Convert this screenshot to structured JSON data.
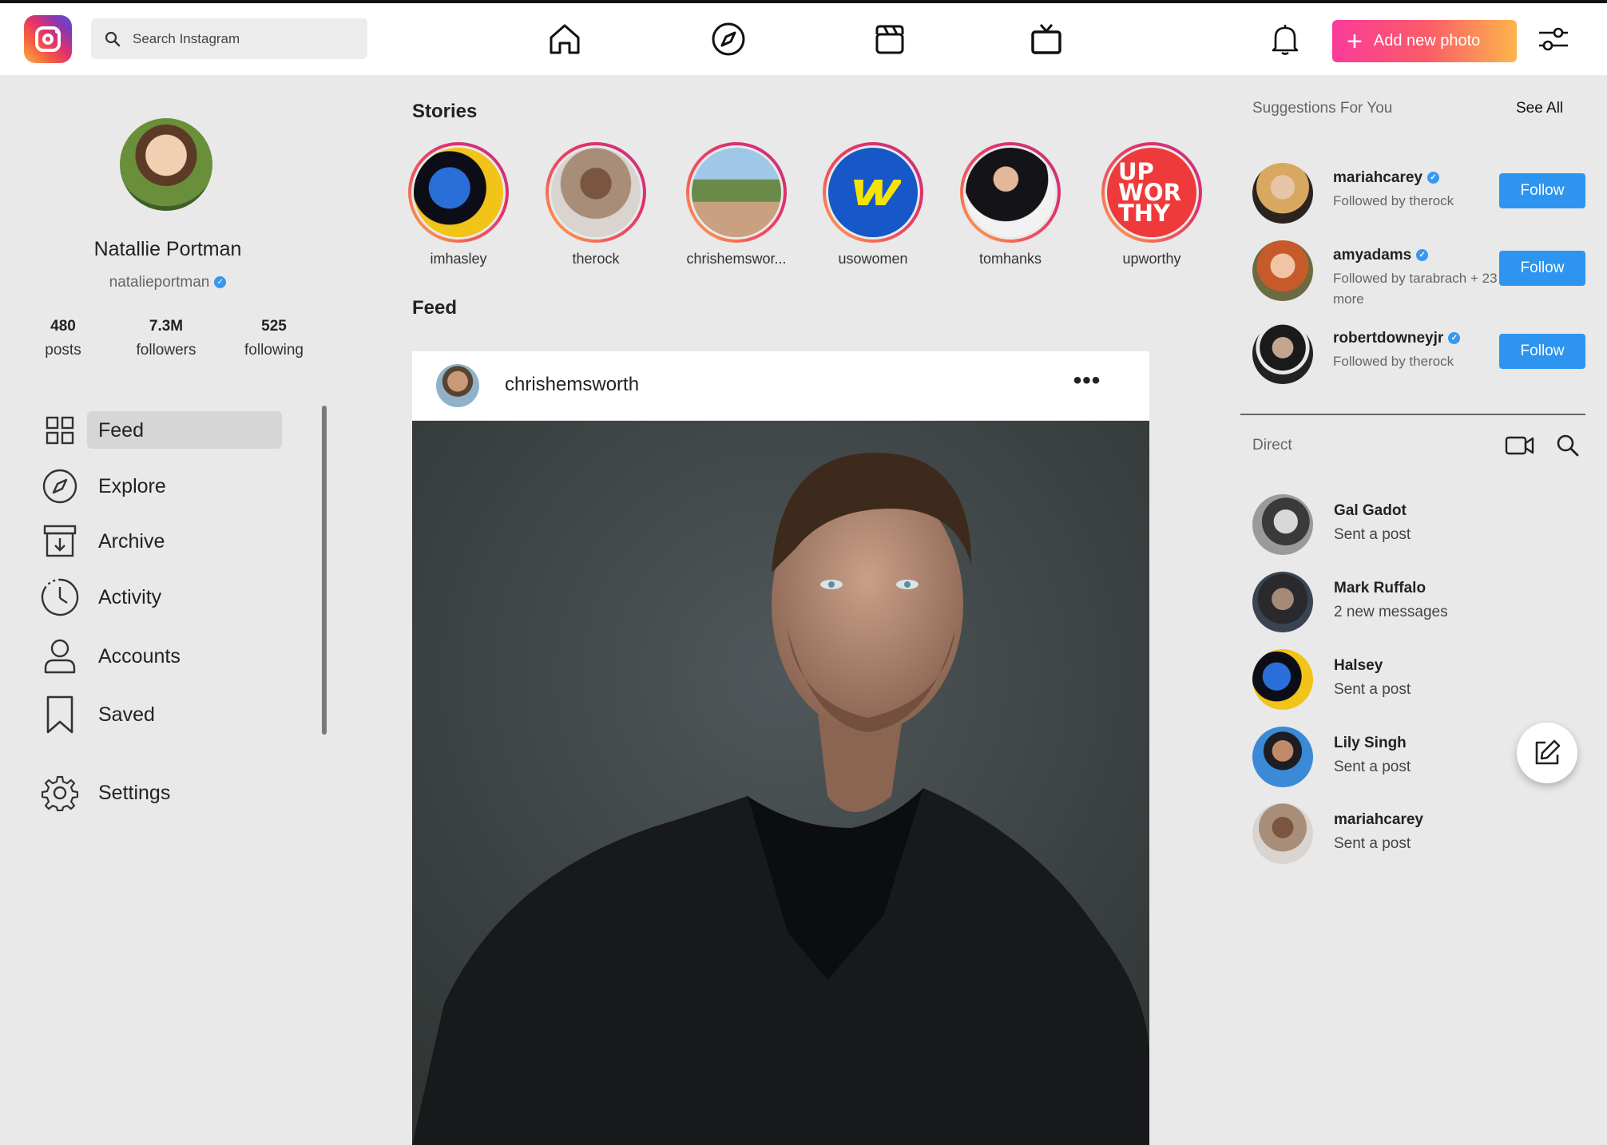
{
  "header": {
    "search_placeholder": "Search Instagram",
    "add_photo_label": "Add new photo",
    "plus_glyph": "+"
  },
  "profile": {
    "name": "Natallie Portman",
    "handle": "natalieportman",
    "stats": [
      {
        "num": "480",
        "label": "posts"
      },
      {
        "num": "7.3M",
        "label": "followers"
      },
      {
        "num": "525",
        "label": "following"
      }
    ]
  },
  "menu": {
    "feed": "Feed",
    "explore": "Explore",
    "archive": "Archive",
    "activity": "Activity",
    "accounts": "Accounts",
    "saved": "Saved",
    "settings": "Settings"
  },
  "stories": {
    "title": "Stories",
    "items": [
      "imhasley",
      "therock",
      "chrishemswor...",
      "usowomen",
      "tomhanks",
      "upworthy"
    ],
    "upworthy_logo_text": "UP WOR THY"
  },
  "feed": {
    "title": "Feed",
    "post": {
      "username": "chrishemsworth",
      "more_glyph": "•••"
    }
  },
  "suggestions": {
    "title": "Suggestions For You",
    "see_all": "See All",
    "follow_label": "Follow",
    "items": [
      {
        "username": "mariahcarey",
        "sub": "Followed by therock"
      },
      {
        "username": "amyadams",
        "sub": "Followed by tarabrach + 23 more"
      },
      {
        "username": "robertdowneyjr",
        "sub": "Followed by therock"
      }
    ]
  },
  "direct": {
    "title": "Direct",
    "items": [
      {
        "name": "Gal Gadot",
        "sub": "Sent a post"
      },
      {
        "name": "Mark Ruffalo",
        "sub": "2 new messages"
      },
      {
        "name": "Halsey",
        "sub": "Sent a post"
      },
      {
        "name": "Lily Singh",
        "sub": "Sent a post"
      },
      {
        "name": "mariahcarey",
        "sub": "Sent a post"
      }
    ]
  },
  "colors": {
    "accent_blue": "#2d95f0",
    "verified_blue": "#3897f0",
    "gradient_pink": "#fb3b9a",
    "gradient_orange": "#fdb44b"
  },
  "verified_glyph": "✓"
}
